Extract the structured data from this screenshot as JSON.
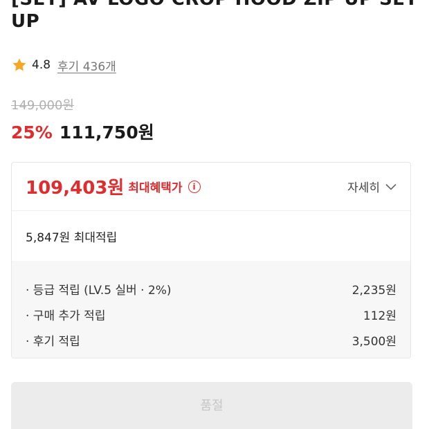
{
  "product": {
    "title_line1": "[SET] AV LOGO CROP HOOD ZIP UP SET",
    "title_line2": "UP"
  },
  "rating": {
    "score": "4.8",
    "reviews_label": "후기 436개",
    "star_color": "#f5a623"
  },
  "pricing": {
    "original": "149,000원",
    "discount": "25%",
    "sale": "111,750원",
    "accent_color": "#e02c2c"
  },
  "benefit": {
    "max_price": "109,403원",
    "max_label": "최대혜택가",
    "info_icon": "i",
    "detail_label": "자세히",
    "points_total": "5,847원 최대적립",
    "breakdown": [
      {
        "label": "· 등급 적립 (LV.5 실버 · 2%)",
        "value": "2,235원"
      },
      {
        "label": "· 구매 추가 적립",
        "value": "112원"
      },
      {
        "label": "· 후기 적립",
        "value": "3,500원"
      }
    ]
  },
  "action": {
    "soldout_label": "품절"
  }
}
